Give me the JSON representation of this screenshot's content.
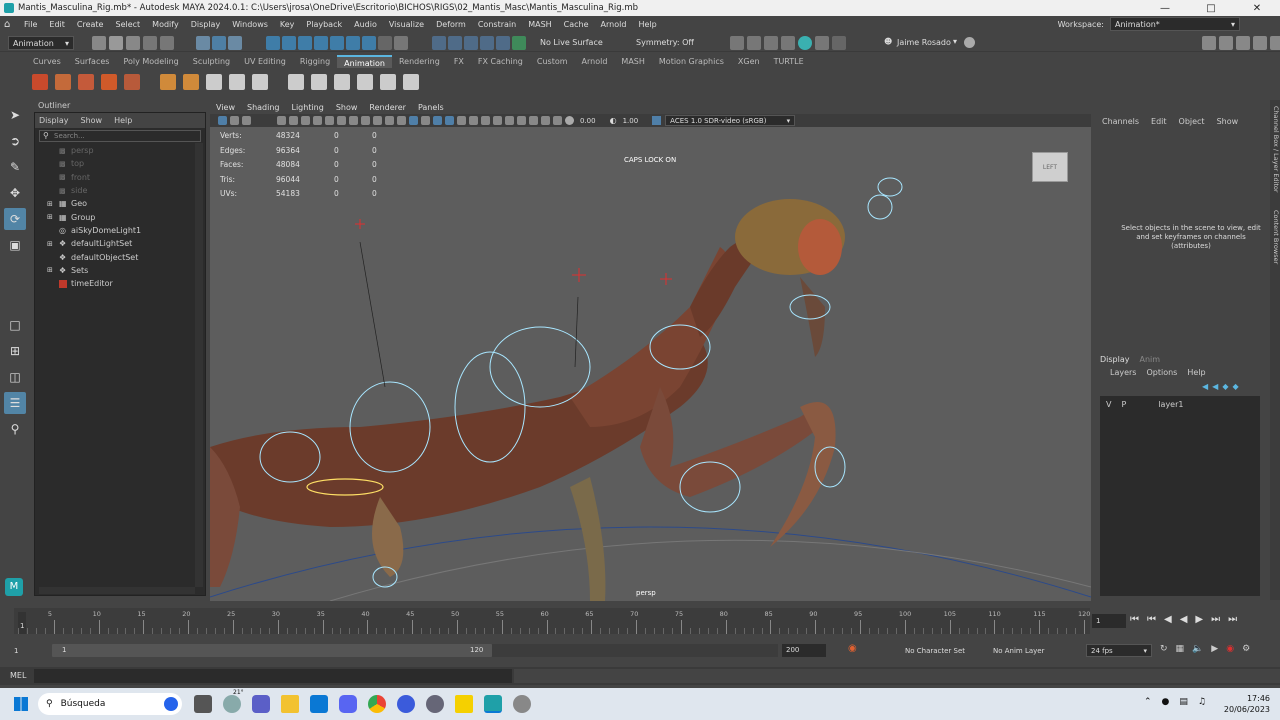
{
  "window": {
    "title": "Mantis_Masculina_Rig.mb* - Autodesk MAYA 2024.0.1: C:\\Users\\jrosa\\OneDrive\\Escritorio\\BICHOS\\RIGS\\02_Mantis_Masc\\Mantis_Masculina_Rig.mb"
  },
  "menubar": {
    "items": [
      "File",
      "Edit",
      "Create",
      "Select",
      "Modify",
      "Display",
      "Windows",
      "Key",
      "Playback",
      "Audio",
      "Visualize",
      "Deform",
      "Constrain",
      "MASH",
      "Cache",
      "Arnold",
      "Help"
    ],
    "workspace_label": "Workspace:",
    "workspace_value": "Animation*"
  },
  "statusline": {
    "menuset": "Animation",
    "live_surface": "No Live Surface",
    "symmetry": "Symmetry: Off",
    "user": "Jaime Rosado"
  },
  "shelf": {
    "tabs": [
      "Curves",
      "Surfaces",
      "Poly Modeling",
      "Sculpting",
      "UV Editing",
      "Rigging",
      "Animation",
      "Rendering",
      "FX",
      "FX Caching",
      "Custom",
      "Arnold",
      "MASH",
      "Motion Graphics",
      "XGen",
      "TURTLE"
    ],
    "active": "Animation"
  },
  "outliner": {
    "title": "Outliner",
    "menu": [
      "Display",
      "Show",
      "Help"
    ],
    "search_placeholder": "Search...",
    "items": [
      {
        "label": "persp",
        "dim": true
      },
      {
        "label": "top",
        "dim": true
      },
      {
        "label": "front",
        "dim": true
      },
      {
        "label": "side",
        "dim": true
      },
      {
        "label": "Geo",
        "dim": false,
        "expand": true
      },
      {
        "label": "Group",
        "dim": false,
        "expand": true
      },
      {
        "label": "aiSkyDomeLight1",
        "dim": false,
        "expand": false
      },
      {
        "label": "defaultLightSet",
        "dim": false,
        "expand": true
      },
      {
        "label": "defaultObjectSet",
        "dim": false,
        "expand": false
      },
      {
        "label": "Sets",
        "dim": false,
        "expand": true
      },
      {
        "label": "timeEditor",
        "dim": false,
        "expand": false
      }
    ]
  },
  "viewport": {
    "menu": [
      "View",
      "Shading",
      "Lighting",
      "Show",
      "Renderer",
      "Panels"
    ],
    "exposure": "0.00",
    "gamma": "1.00",
    "colorspace": "ACES 1.0 SDR-video (sRGB)",
    "hud": [
      {
        "label": "Verts:",
        "v1": "48324",
        "v2": "0",
        "v3": "0"
      },
      {
        "label": "Edges:",
        "v1": "96364",
        "v2": "0",
        "v3": "0"
      },
      {
        "label": "Faces:",
        "v1": "48084",
        "v2": "0",
        "v3": "0"
      },
      {
        "label": "Tris:",
        "v1": "96044",
        "v2": "0",
        "v3": "0"
      },
      {
        "label": "UVs:",
        "v1": "54183",
        "v2": "0",
        "v3": "0"
      }
    ],
    "caps_lock": "CAPS LOCK ON",
    "view_cube": "LEFT",
    "camera": "persp"
  },
  "channelbox": {
    "menu": [
      "Channels",
      "Edit",
      "Object",
      "Show"
    ],
    "message": "Select objects in the scene to view, edit and set keyframes on channels (attributes)"
  },
  "layereditor": {
    "tabs": [
      "Display",
      "Anim"
    ],
    "menu": [
      "Layers",
      "Options",
      "Help"
    ],
    "layer_v": "V",
    "layer_p": "P",
    "layer_name": "layer1"
  },
  "side_tabs": {
    "a": "Channel Box / Layer Editor",
    "b": "Content Browser"
  },
  "timeslider": {
    "ticks": [
      "5",
      "10",
      "15",
      "20",
      "25",
      "30",
      "35",
      "40",
      "45",
      "50",
      "55",
      "60",
      "65",
      "70",
      "75",
      "80",
      "85",
      "90",
      "95",
      "100",
      "105",
      "110",
      "115",
      "120"
    ],
    "current_frame_label": "1",
    "current_frame_field": "1"
  },
  "range": {
    "start": "1",
    "inner_start": "1",
    "inner_end": "120",
    "end": "200",
    "character_set": "No Character Set",
    "anim_layer": "No Anim Layer",
    "fps": "24 fps"
  },
  "cmdline": {
    "label": "MEL"
  },
  "taskbar": {
    "search_label": "Búsqueda",
    "weather_temp": "21°",
    "time": "17:46",
    "date": "20/06/2023"
  }
}
